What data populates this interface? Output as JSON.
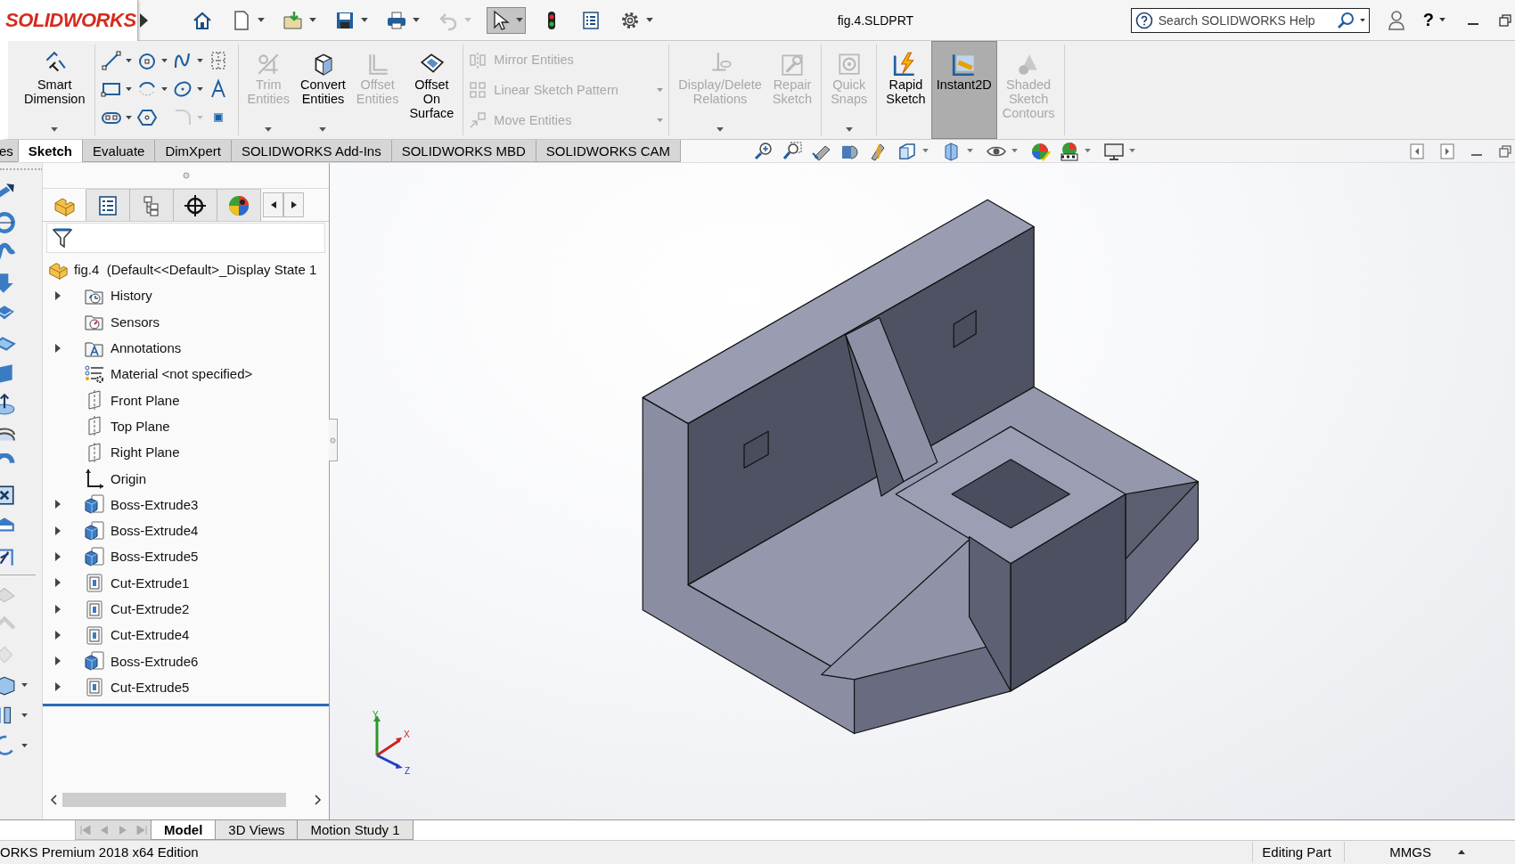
{
  "title_bar": {
    "logo": "SOLIDWORKS",
    "document_title": "fig.4.SLDPRT",
    "search": {
      "placeholder": "Search SOLIDWORKS Help"
    },
    "help_label": "?"
  },
  "quick_access": [
    {
      "kind": "home",
      "dropdown": false,
      "disabled": false,
      "selected": false
    },
    {
      "kind": "new",
      "dropdown": true,
      "disabled": false,
      "selected": false
    },
    {
      "kind": "open",
      "dropdown": true,
      "disabled": false,
      "selected": false
    },
    {
      "kind": "save",
      "dropdown": true,
      "disabled": false,
      "selected": false
    },
    {
      "kind": "print",
      "dropdown": true,
      "disabled": false,
      "selected": false
    },
    {
      "kind": "undo",
      "dropdown": true,
      "disabled": true,
      "selected": false
    },
    {
      "kind": "select",
      "dropdown": true,
      "disabled": false,
      "selected": true
    },
    {
      "kind": "rebuild",
      "dropdown": false,
      "disabled": false,
      "selected": false
    },
    {
      "kind": "properties",
      "dropdown": false,
      "disabled": false,
      "selected": false
    },
    {
      "kind": "options",
      "dropdown": true,
      "disabled": false,
      "selected": false
    }
  ],
  "ribbon_groups": [
    {
      "kind": "large",
      "items": [
        {
          "label": "Smart Dimension",
          "dropdown": true,
          "disabled": false,
          "selected": false
        }
      ]
    },
    {
      "kind": "sketch_tools"
    },
    {
      "kind": "large",
      "items": [
        {
          "label": "Trim Entities",
          "dropdown": true,
          "disabled": true,
          "selected": false
        },
        {
          "label": "Convert Entities",
          "dropdown": true,
          "disabled": false,
          "selected": false
        },
        {
          "label": "Offset Entities",
          "dropdown": false,
          "disabled": true,
          "selected": false
        },
        {
          "label": "Offset On Surface",
          "dropdown": false,
          "disabled": false,
          "selected": false
        }
      ]
    },
    {
      "kind": "list",
      "items": [
        {
          "label": "Mirror Entities",
          "dropdown": false,
          "disabled": true,
          "selected": false
        },
        {
          "label": "Linear Sketch Pattern",
          "dropdown": true,
          "disabled": true,
          "selected": false
        },
        {
          "label": "Move Entities",
          "dropdown": true,
          "disabled": true,
          "selected": false
        }
      ]
    },
    {
      "kind": "large",
      "items": [
        {
          "label": "Display/Delete Relations",
          "dropdown": true,
          "disabled": true,
          "selected": false
        },
        {
          "label": "Repair Sketch",
          "dropdown": false,
          "disabled": true,
          "selected": false
        }
      ]
    },
    {
      "kind": "large",
      "items": [
        {
          "label": "Quick Snaps",
          "dropdown": true,
          "disabled": true,
          "selected": false
        }
      ]
    },
    {
      "kind": "large",
      "items": [
        {
          "label": "Rapid Sketch",
          "dropdown": false,
          "disabled": false,
          "selected": false
        },
        {
          "label": "Instant2D",
          "dropdown": false,
          "disabled": false,
          "selected": true
        },
        {
          "label": "Shaded Sketch Contours",
          "dropdown": false,
          "disabled": true,
          "selected": false
        }
      ]
    }
  ],
  "command_tabs": [
    {
      "label": "es",
      "selected": false
    },
    {
      "label": "Sketch",
      "selected": true
    },
    {
      "label": "Evaluate",
      "selected": false
    },
    {
      "label": "DimXpert",
      "selected": false
    },
    {
      "label": "SOLIDWORKS Add-Ins",
      "selected": false
    },
    {
      "label": "SOLIDWORKS MBD",
      "selected": false
    },
    {
      "label": "SOLIDWORKS CAM",
      "selected": false
    }
  ],
  "feature_tree": {
    "panel_tabs": [
      {
        "kind": "feature_manager",
        "selected": true
      },
      {
        "kind": "property_manager",
        "selected": false
      },
      {
        "kind": "configuration_manager",
        "selected": false
      },
      {
        "kind": "dimxpert_manager",
        "selected": false
      },
      {
        "kind": "display_manager",
        "selected": false
      }
    ],
    "root": {
      "label": "fig.4  (Default<<Default>_Display State 1"
    },
    "items": [
      {
        "kind": "history",
        "label": "History",
        "expandable": true
      },
      {
        "kind": "sensors",
        "label": "Sensors",
        "expandable": false
      },
      {
        "kind": "annotations",
        "label": "Annotations",
        "expandable": true
      },
      {
        "kind": "material",
        "label": "Material <not specified>",
        "expandable": false
      },
      {
        "kind": "plane",
        "label": "Front Plane",
        "expandable": false
      },
      {
        "kind": "plane",
        "label": "Top Plane",
        "expandable": false
      },
      {
        "kind": "plane",
        "label": "Right Plane",
        "expandable": false
      },
      {
        "kind": "origin",
        "label": "Origin",
        "expandable": false
      },
      {
        "kind": "boss",
        "label": "Boss-Extrude3",
        "expandable": true
      },
      {
        "kind": "boss",
        "label": "Boss-Extrude4",
        "expandable": true
      },
      {
        "kind": "boss",
        "label": "Boss-Extrude5",
        "expandable": true
      },
      {
        "kind": "cut",
        "label": "Cut-Extrude1",
        "expandable": true
      },
      {
        "kind": "cut",
        "label": "Cut-Extrude2",
        "expandable": true
      },
      {
        "kind": "cut",
        "label": "Cut-Extrude4",
        "expandable": true
      },
      {
        "kind": "boss",
        "label": "Boss-Extrude6",
        "expandable": true
      },
      {
        "kind": "cut",
        "label": "Cut-Extrude5",
        "expandable": true
      }
    ]
  },
  "triad": {
    "x_label": "X",
    "y_label": "Y",
    "z_label": "Z"
  },
  "bottom_tabs": [
    {
      "label": "Model",
      "selected": true
    },
    {
      "label": "3D Views",
      "selected": false
    },
    {
      "label": "Motion Study 1",
      "selected": false
    }
  ],
  "status_bar": {
    "edition": "ORKS Premium 2018 x64 Edition",
    "mode": "Editing Part",
    "units": "MMGS"
  }
}
